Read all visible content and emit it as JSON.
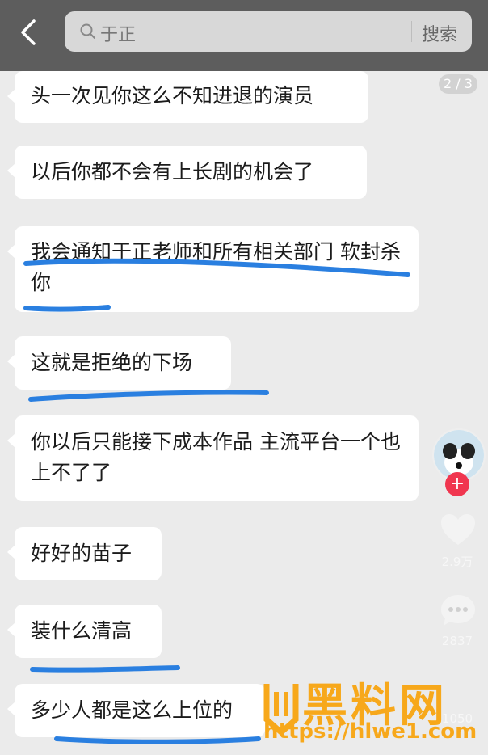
{
  "search": {
    "query": "于正",
    "button": "搜索"
  },
  "page_indicator": "2 / 3",
  "messages": [
    "头一次见你这么不知进退的演员",
    "以后你都不会有上长剧的机会了",
    "我会通知于正老师和所有相关部门 软封杀你",
    "这就是拒绝的下场",
    "你以后只能接下成本作品 主流平台一个也上不了了",
    "好好的苗子",
    "装什么清高",
    "多少人都是这么上位的"
  ],
  "side": {
    "likes": "2.9万",
    "comments": "2837",
    "shares": "1050"
  },
  "watermark": {
    "brand": "黑料网",
    "url": "https://hlwe1.com"
  },
  "colors": {
    "topbar": "#5d5d5d",
    "background": "#ebebeb",
    "underline": "#2a7fe0",
    "watermark": "#f7a81b"
  }
}
